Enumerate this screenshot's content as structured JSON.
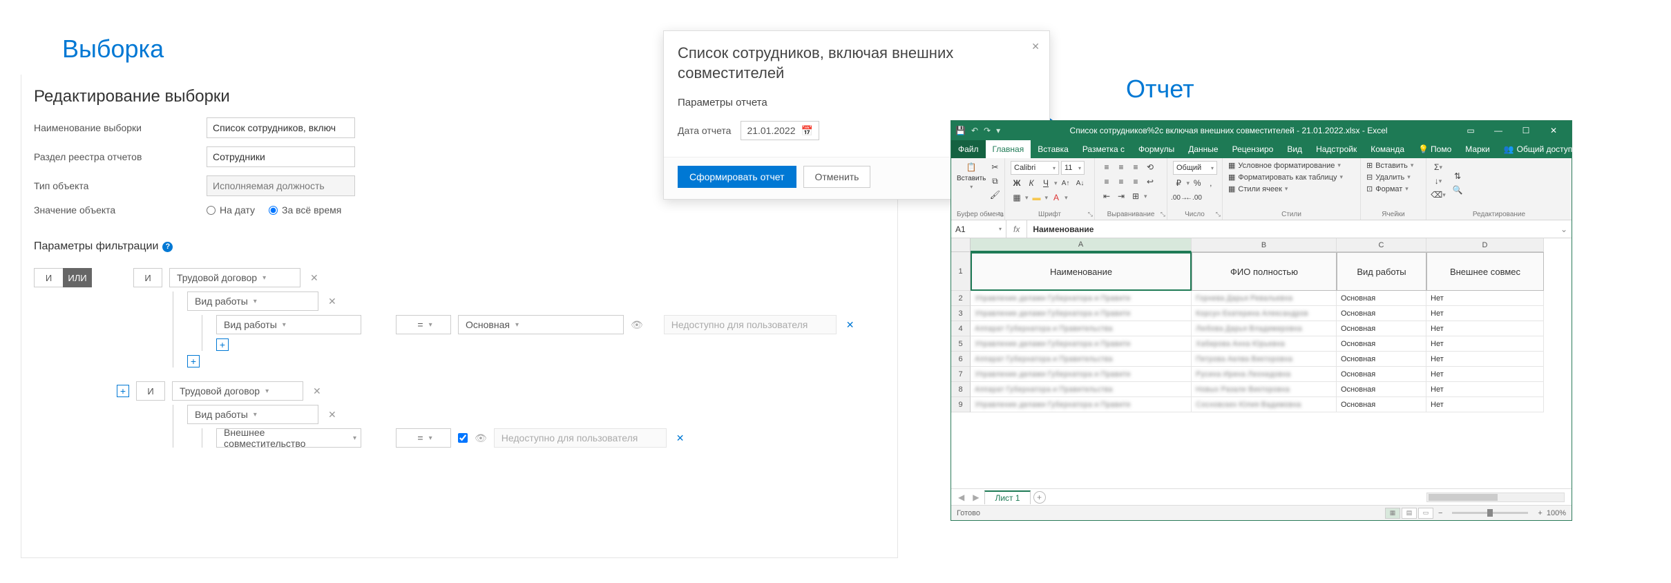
{
  "labels": {
    "selection": "Выборка",
    "report": "Отчет"
  },
  "panel": {
    "title": "Редактирование выборки",
    "name_label": "Наименование выборки",
    "name_value": "Список сотрудников, включ",
    "section_label": "Раздел реестра отчетов",
    "section_value": "Сотрудники",
    "type_label": "Тип объекта",
    "type_value": "Исполняемая должность",
    "value_label": "Значение объекта",
    "radio_date": "На дату",
    "radio_all": "За всё время",
    "filter_title": "Параметры фильтрации",
    "and": "И",
    "or": "ИЛИ",
    "labor_contract": "Трудовой договор",
    "work_type": "Вид работы",
    "main_work": "Основная",
    "external_pt": "Внешнее совместительство",
    "eq": "=",
    "unavailable": "Недоступно для пользователя"
  },
  "modal": {
    "title": "Список сотрудников, включая внешних совместителей",
    "params": "Параметры отчета",
    "date_label": "Дата отчета",
    "date_value": "21.01.2022",
    "generate": "Сформировать отчет",
    "cancel": "Отменить"
  },
  "excel": {
    "title": "Список сотрудников%2с включая внешних совместителей - 21.01.2022.xlsx - Excel",
    "tabs": {
      "file": "Файл",
      "home": "Главная",
      "insert": "Вставка",
      "layout": "Разметка с",
      "formulas": "Формулы",
      "data": "Данные",
      "review": "Рецензиро",
      "view": "Вид",
      "addins": "Надстройк",
      "team": "Команда",
      "tell": "Помо",
      "signed": "Марки",
      "share": "Общий доступ"
    },
    "ribbon": {
      "paste": "Вставить",
      "font_name": "Calibri",
      "font_size": "11",
      "number_format": "Общий",
      "cond_fmt": "Условное форматирование",
      "as_table": "Форматировать как таблицу",
      "cell_styles": "Стили ячеек",
      "insert_c": "Вставить",
      "delete_c": "Удалить",
      "format_c": "Формат",
      "g_clipboard": "Буфер обмена",
      "g_font": "Шрифт",
      "g_align": "Выравнивание",
      "g_number": "Число",
      "g_styles": "Стили",
      "g_cells": "Ячейки",
      "g_edit": "Редактирование"
    },
    "name_box": "A1",
    "formula": "Наименование",
    "cols": [
      "A",
      "B",
      "C",
      "D"
    ],
    "headers": {
      "a": "Наименование",
      "b": "ФИО полностью",
      "c": "Вид работы",
      "d": "Внешнее совмес"
    },
    "rows": [
      {
        "n": "2",
        "a": "Управление делами Губернатора и Правите",
        "b": "Горнева Дарья Ревальевна",
        "c": "Основная",
        "d": "Нет"
      },
      {
        "n": "3",
        "a": "Управление делами Губернатора и Правите",
        "b": "Корсун Екатерина Александров",
        "c": "Основная",
        "d": "Нет"
      },
      {
        "n": "4",
        "a": "Аппарат Губернатора и Правительства",
        "b": "Любова Дарья Владимировна",
        "c": "Основная",
        "d": "Нет"
      },
      {
        "n": "5",
        "a": "Управление делами Губернатора и Правите",
        "b": "Хабирова Анна Юрьевна",
        "c": "Основная",
        "d": "Нет"
      },
      {
        "n": "6",
        "a": "Аппарат Губернатора и Правительства",
        "b": "Петрова Аелва Викторовна",
        "c": "Основная",
        "d": "Нет"
      },
      {
        "n": "7",
        "a": "Управление делами Губернатора и Правите",
        "b": "Русина Ирина Леонидовна",
        "c": "Основная",
        "d": "Нет"
      },
      {
        "n": "8",
        "a": "Аппарат Губернатора и Правительства",
        "b": "Новых Разале Викторовна",
        "c": "Основная",
        "d": "Нет"
      },
      {
        "n": "9",
        "a": "Управление делами Губернатора и Правите",
        "b": "Сосновских Юлия Вадимовна",
        "c": "Основная",
        "d": "Нет"
      }
    ],
    "sheet": "Лист 1",
    "status": "Готово",
    "zoom": "100%"
  }
}
